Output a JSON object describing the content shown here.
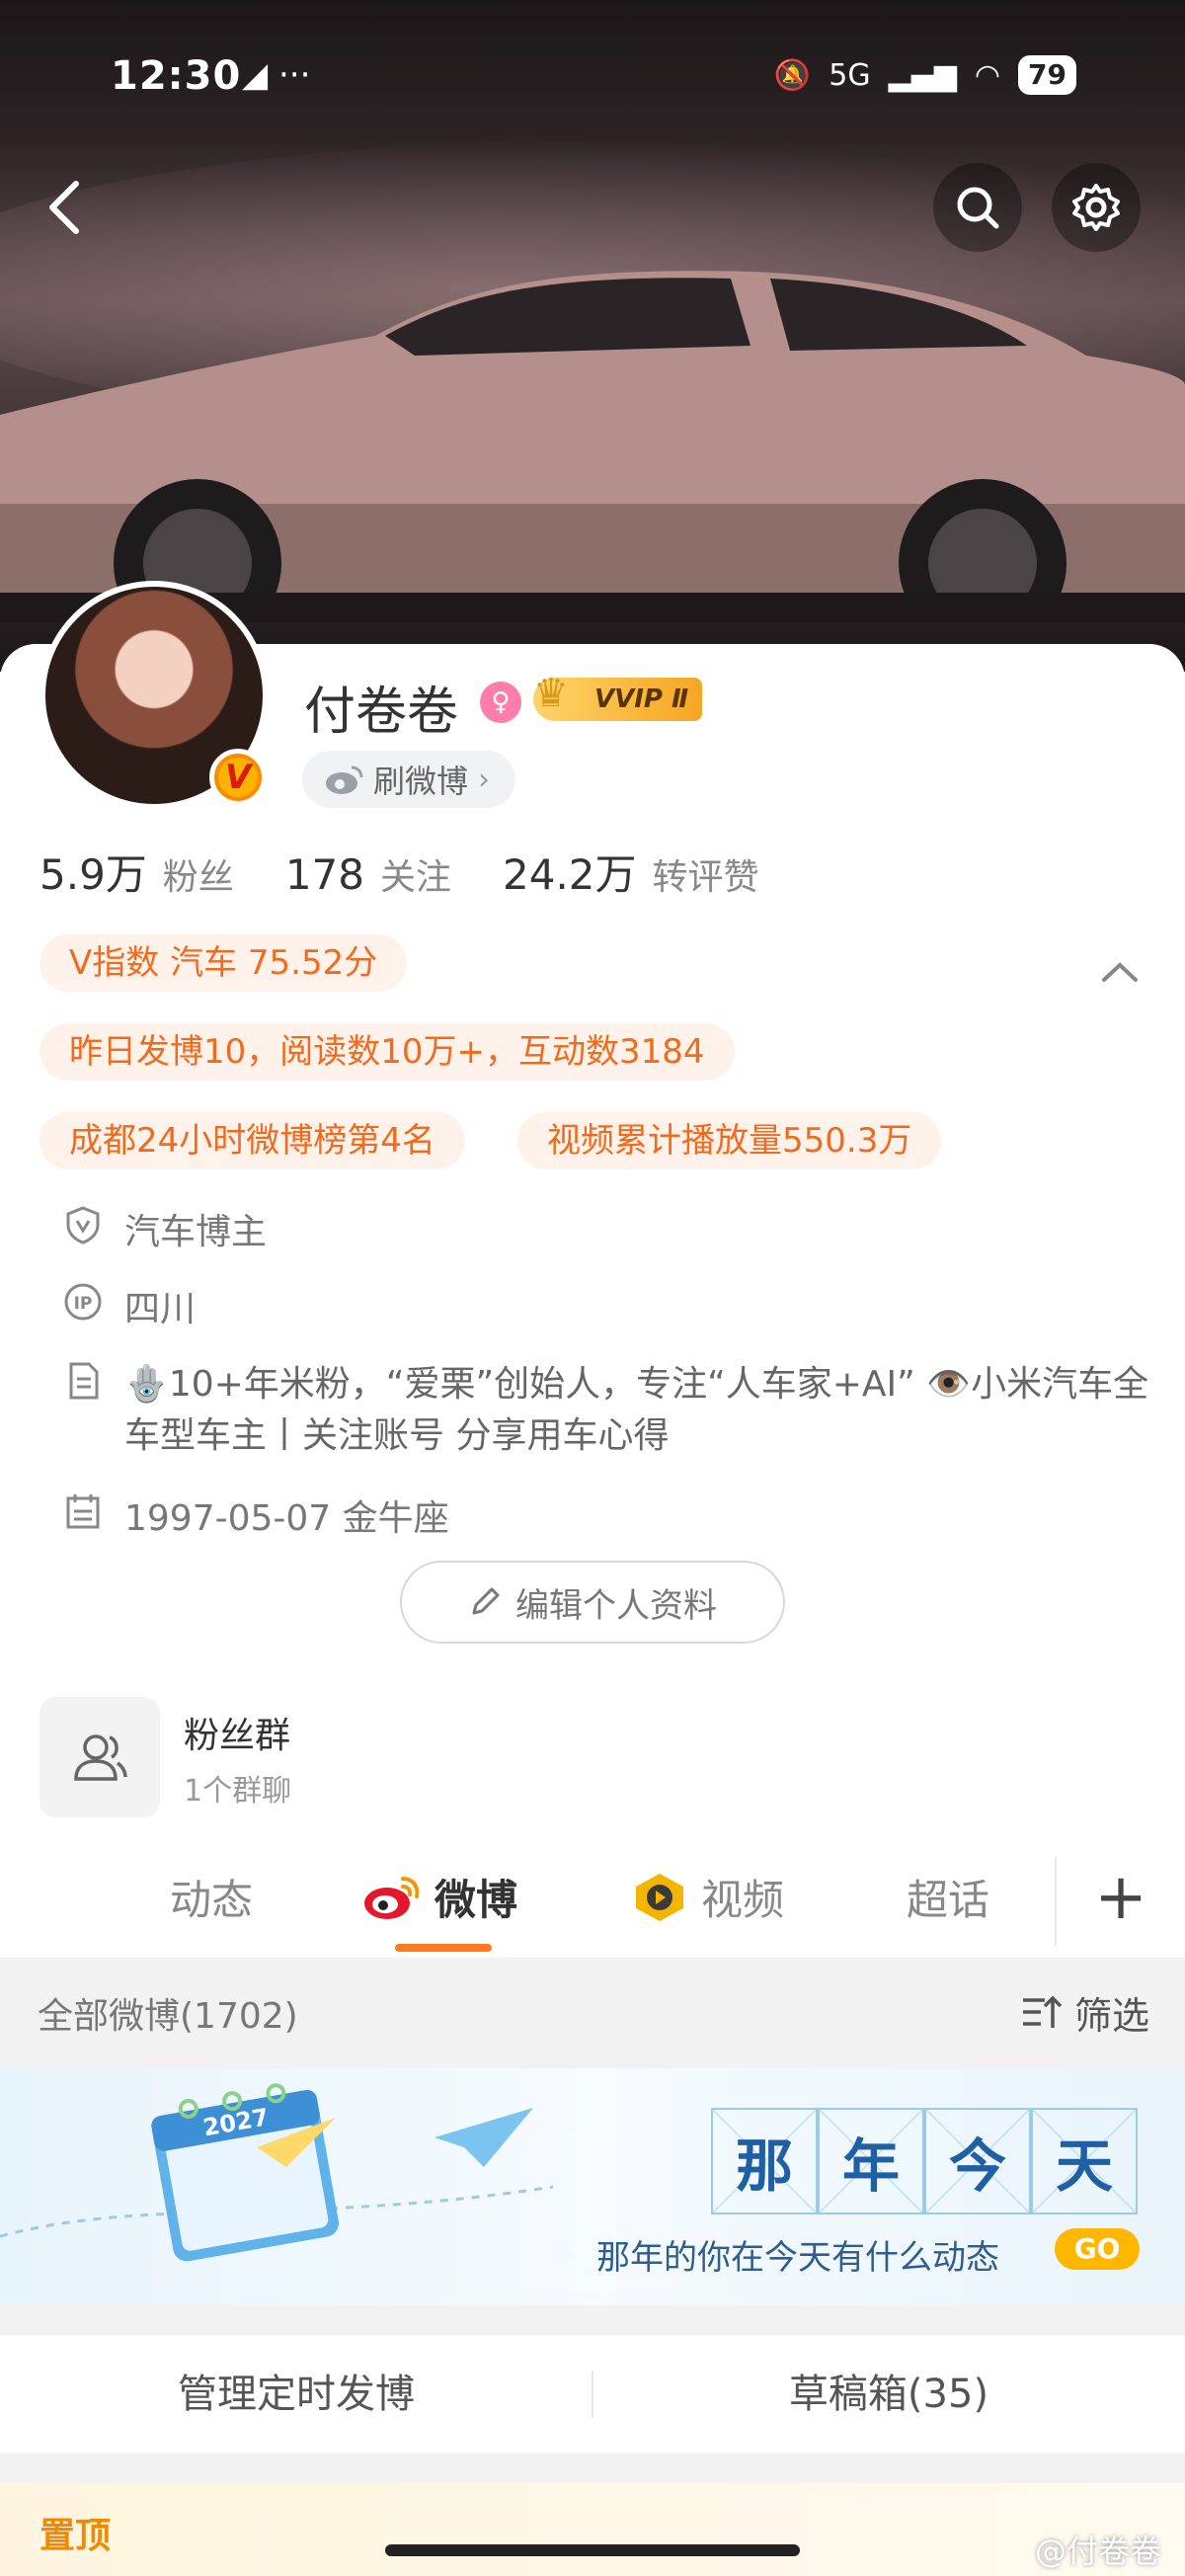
{
  "status_bar": {
    "time": "12:30",
    "left_icons": "◢ ···",
    "network": "5G",
    "battery": "79"
  },
  "profile": {
    "name": "付卷卷",
    "gender_symbol": "♀",
    "vip_label": "VVIP Ⅱ",
    "verified_badge": "V",
    "shua_label": "刷微博"
  },
  "stats": [
    {
      "value": "5.9万",
      "label": "粉丝"
    },
    {
      "value": "178",
      "label": "关注"
    },
    {
      "value": "24.2万",
      "label": "转评赞"
    }
  ],
  "pills": {
    "v_index": "V指数 汽车 75.52分",
    "yesterday": "昨日发博10，阅读数10万+，互动数3184",
    "ranking": "成都24小时微博榜第4名",
    "video_plays": "视频累计播放量550.3万"
  },
  "info": {
    "category": "汽车博主",
    "ip": "四川",
    "bio": "🪬10+年米粉，“爱栗”创始人，专注“人车家+AI” 👁️小米汽车全车型车主丨关注账号 分享用车心得",
    "birthday": "1997-05-07 金牛座"
  },
  "edit_profile_label": "编辑个人资料",
  "fans_group": {
    "title": "粉丝群",
    "subtitle": "1个群聊"
  },
  "tabs": [
    {
      "label": "动态"
    },
    {
      "label": "微博"
    },
    {
      "label": "视频"
    },
    {
      "label": "超话"
    }
  ],
  "filter": {
    "all_posts": "全部微博(1702)",
    "filter_label": "筛选"
  },
  "banner": {
    "title_chars": [
      "那",
      "年",
      "今",
      "天"
    ],
    "subtitle": "那年的你在今天有什么动态",
    "go": "GO",
    "calendar_year": "2027"
  },
  "manage": {
    "scheduled": "管理定时发博",
    "drafts": "草稿箱(35)"
  },
  "pinned_label": "置顶",
  "watermark": "@付卷卷",
  "colors": {
    "accent": "#ff7a1a",
    "pill_text": "#f26b1d",
    "pill_bg": "#fff2ea"
  }
}
